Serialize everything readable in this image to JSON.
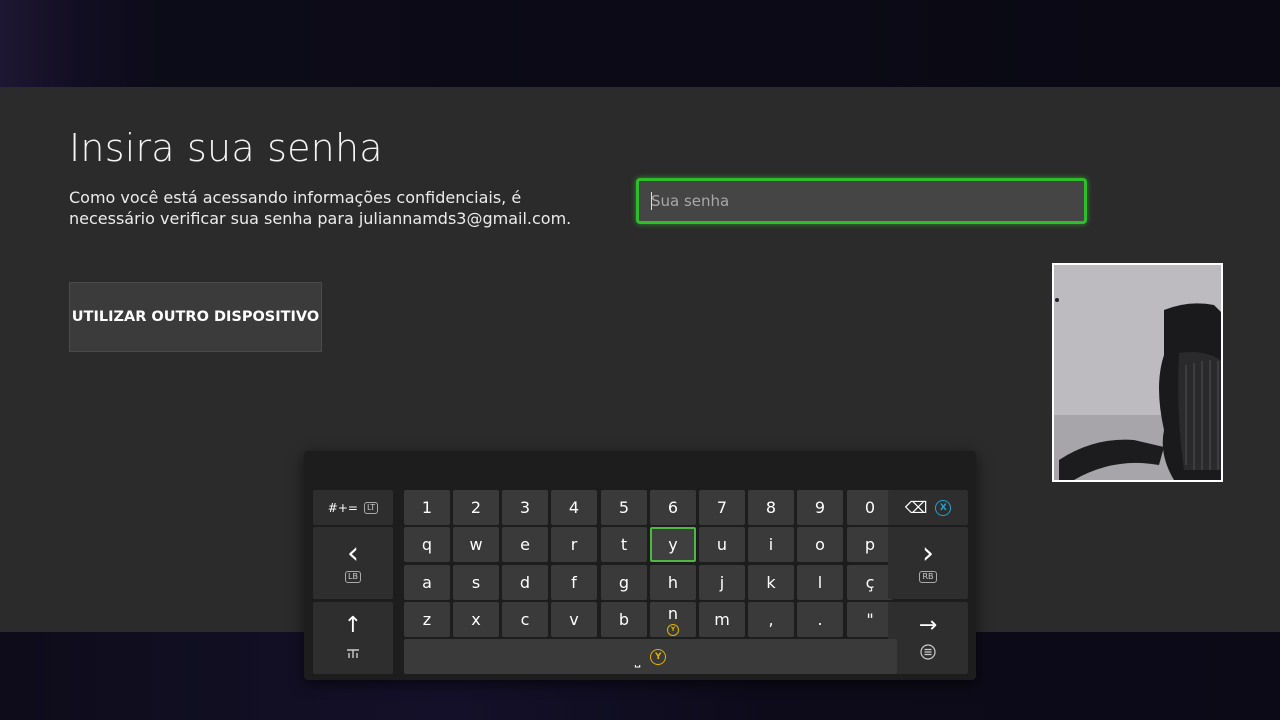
{
  "page": {
    "title": "Insira sua senha",
    "description_line1": "Como você está acessando informações confidenciais, é",
    "description_line2": "necessário verificar sua senha para juliannamds3@gmail.com.",
    "other_device_button": "UTILIZAR OUTRO DISPOSITIVO",
    "password_placeholder": "Sua senha",
    "password_value": ""
  },
  "keyboard": {
    "symbols_key": "#+=",
    "symbols_hint": "LT",
    "left_arrow": "‹",
    "left_hint": "LB",
    "right_arrow": "›",
    "right_hint": "RB",
    "shift": "↑",
    "enter": "→",
    "backspace": "⌫",
    "backspace_badge": "X",
    "space_symbol": "⎵",
    "space_badge": "Y",
    "row1": [
      "1",
      "2",
      "3",
      "4",
      "5",
      "6",
      "7",
      "8",
      "9",
      "0"
    ],
    "row2": [
      "q",
      "w",
      "e",
      "r",
      "t",
      "y",
      "u",
      "i",
      "o",
      "p"
    ],
    "row3": [
      "a",
      "s",
      "d",
      "f",
      "g",
      "h",
      "j",
      "k",
      "l",
      "ç"
    ],
    "row4": [
      "z",
      "x",
      "c",
      "v",
      "b",
      "n",
      "m",
      ",",
      ".",
      "\""
    ],
    "selected_key": "y",
    "n_badge": "Y"
  },
  "colors": {
    "accent_green": "#2fbd2b",
    "badge_blue": "#1fa3d8",
    "badge_yellow": "#e0b400"
  }
}
